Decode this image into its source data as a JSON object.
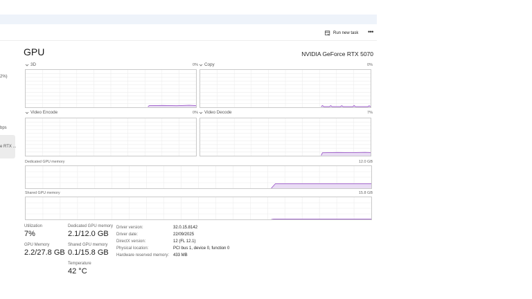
{
  "toolbar": {
    "run_new_task": "Run new task",
    "more_label": "•••",
    "run_icon": "run-task-icon"
  },
  "sidebar": {
    "fragments": [
      "2%)",
      "bps",
      "e RTX ..."
    ]
  },
  "header": {
    "title": "GPU",
    "model": "NVIDIA GeForce RTX 5070"
  },
  "engines": [
    {
      "name": "3D",
      "percent": "0%"
    },
    {
      "name": "Copy",
      "percent": "0%"
    },
    {
      "name": "Video Encode",
      "percent": "0%"
    },
    {
      "name": "Video Decode",
      "percent": "7%"
    }
  ],
  "memory_graphs": {
    "dedicated": {
      "label": "Dedicated GPU memory",
      "max": "12.0 GB"
    },
    "shared": {
      "label": "Shared GPU memory",
      "max": "15.8 GB"
    }
  },
  "stats": {
    "utilization": {
      "label": "Utilization",
      "value": "7%"
    },
    "dedicated_mem": {
      "label": "Dedicated GPU memory",
      "value": "2.1/12.0 GB"
    },
    "gpu_memory": {
      "label": "GPU Memory",
      "value": "2.2/27.8 GB"
    },
    "shared_mem": {
      "label": "Shared GPU memory",
      "value": "0.1/15.8 GB"
    },
    "temperature": {
      "label": "Temperature",
      "value": "42 °C"
    }
  },
  "details": [
    {
      "key": "Driver version:",
      "value": "32.0.15.8142"
    },
    {
      "key": "Driver date:",
      "value": "22/09/2025"
    },
    {
      "key": "DirectX version:",
      "value": "12 (FL 12.1)"
    },
    {
      "key": "Physical location:",
      "value": "PCI bus 1, device 0, function 0"
    },
    {
      "key": "Hardware reserved memory:",
      "value": "433 MB"
    }
  ],
  "colors": {
    "graph_line": "#9b59c8",
    "graph_fill": "#e9dcf4",
    "grid": "#ececec",
    "border": "#c9c9c9"
  }
}
